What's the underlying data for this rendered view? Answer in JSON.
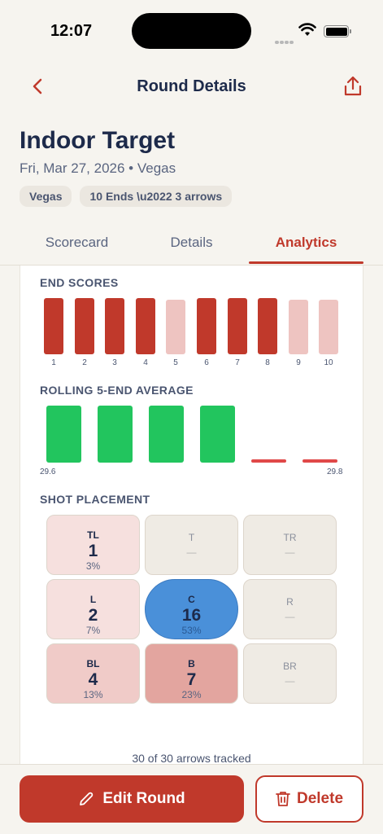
{
  "status": {
    "time": "12:07"
  },
  "nav": {
    "title": "Round Details"
  },
  "round": {
    "title": "Indoor Target",
    "subtitle": "Fri, Mar 27, 2026 • Vegas",
    "chips": [
      "Vegas",
      "10 Ends \\u2022 3 arrows"
    ]
  },
  "tabs": [
    "Scorecard",
    "Details",
    "Analytics"
  ],
  "active_tab": "Analytics",
  "sections": {
    "end_scores": "END SCORES",
    "rolling": "ROLLING 5-END AVERAGE",
    "placement": "SHOT PLACEMENT"
  },
  "end_scores": {
    "labels": [
      "1",
      "2",
      "3",
      "4",
      "5",
      "6",
      "7",
      "8",
      "9",
      "10"
    ],
    "highlight": [
      true,
      true,
      true,
      true,
      false,
      true,
      true,
      true,
      false,
      false
    ]
  },
  "rolling": {
    "min_label": "29.6",
    "max_label": "29.8",
    "bars": [
      "bar",
      "bar",
      "bar",
      "bar",
      "dash",
      "dash"
    ]
  },
  "placement": {
    "cells": [
      {
        "key": "TL",
        "count": "1",
        "pct": "3%",
        "style": "lvl1"
      },
      {
        "key": "T",
        "count": "",
        "pct": "—",
        "style": "empty"
      },
      {
        "key": "TR",
        "count": "",
        "pct": "—",
        "style": "empty"
      },
      {
        "key": "L",
        "count": "2",
        "pct": "7%",
        "style": "lvl1"
      },
      {
        "key": "C",
        "count": "16",
        "pct": "53%",
        "style": "center"
      },
      {
        "key": "R",
        "count": "",
        "pct": "—",
        "style": "empty"
      },
      {
        "key": "BL",
        "count": "4",
        "pct": "13%",
        "style": "lvl2"
      },
      {
        "key": "B",
        "count": "7",
        "pct": "23%",
        "style": "lvl3"
      },
      {
        "key": "BR",
        "count": "",
        "pct": "—",
        "style": "empty"
      }
    ],
    "tracked": "30 of 30 arrows tracked"
  },
  "actions": {
    "edit": "Edit Round",
    "delete": "Delete"
  },
  "colors": {
    "accent": "#c0392b",
    "green": "#22c55e",
    "blue": "#4a90d9"
  }
}
